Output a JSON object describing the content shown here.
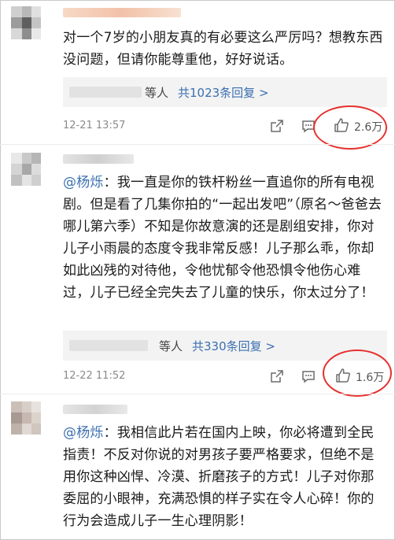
{
  "comments": [
    {
      "text": "对一个7岁的小朋友真的有必要这么严厉吗？想教东西没问题，但请你能尊重他，好好说话。",
      "replies_who": "等人",
      "replies_count": "共1023条回复 >",
      "time": "12-21 13:57",
      "likes": "2.6万"
    },
    {
      "mention": "@杨烁",
      "text": "：我一直是你的铁杆粉丝一直追你的所有电视剧。但是看了几集你拍的“一起出发吧”（原名～爸爸去哪儿第六季）不知是你故意演的还是剧组安排，你对儿子小雨晨的态度令我非常反感！儿子那么乖，你却如此凶残的对待他，令他忧郁令他恐惧令他伤心难过，儿子已经全完失去了儿童的快乐，你太过分了！",
      "replies_who": "等人",
      "replies_count": "共330条回复 >",
      "time": "12-22 11:52",
      "likes": "1.6万"
    },
    {
      "mention": "@杨烁",
      "text": "：我相信此片若在国内上映，你必将遭到全民指责！不反对你说的对男孩子要严格要求，但绝不是用你这种凶悍、冷漠、折磨孩子的方式！儿子对你那委屈的小眼神，充满恐惧的样子实在令人心碎！你的行为会造成儿子一生心理阴影！"
    }
  ],
  "colors": {
    "link": "#3b6fb0",
    "highlight_circle": "#e5302e",
    "reply_bg": "#f3f3f3"
  },
  "icons": [
    "share-icon",
    "comment-icon",
    "thumbs-up-icon"
  ]
}
